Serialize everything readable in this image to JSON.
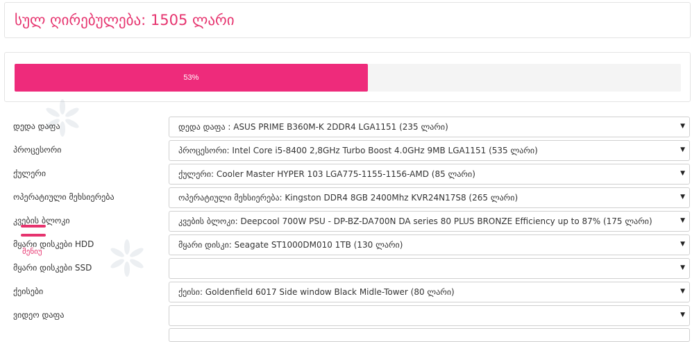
{
  "total": {
    "label": "სულ ღირებულება: 1505 ლარი"
  },
  "progress": {
    "percent": 53,
    "label": "53%"
  },
  "components": [
    {
      "label": "დედა დაფა",
      "value": "დედა დაფა : ASUS PRIME B360M-K 2DDR4 LGA1151 (235 ლარი)"
    },
    {
      "label": "პროცესორი",
      "value": "პროცესორი: Intel Core i5-8400 2,8GHz Turbo Boost 4.0GHz 9MB LGA1151 (535 ლარი)"
    },
    {
      "label": "ქულერი",
      "value": "ქულერი: Cooler Master HYPER 103 LGA775-1155-1156-AMD (85 ლარი)"
    },
    {
      "label": "ოპერატიული მეხსიერება",
      "value": "ოპერატიული მეხსიერება: Kingston DDR4 8GB 2400Mhz KVR24N17S8 (265 ლარი)"
    },
    {
      "label": "კვების ბლოკი",
      "value": "კვების ბლოკი: Deepcool 700W PSU - DP-BZ-DA700N DA series 80 PLUS BRONZE Efficiency up to 87% (175 ლარი)"
    },
    {
      "label": "მყარი დისკები HDD",
      "value": "მყარი დისკი: Seagate ST1000DM010 1TB (130 ლარი)"
    },
    {
      "label": "მყარი დისკები SSD",
      "value": ""
    },
    {
      "label": "ქეისები",
      "value": "ქეისი: Goldenfield 6017 Side window Black Midle-Tower (80 ლარი)"
    },
    {
      "label": "ვიდეო დაფა",
      "value": ""
    }
  ],
  "menu": {
    "label": "მენიუ"
  },
  "colors": {
    "accent": "#ee2b7b",
    "title": "#e6336e"
  }
}
